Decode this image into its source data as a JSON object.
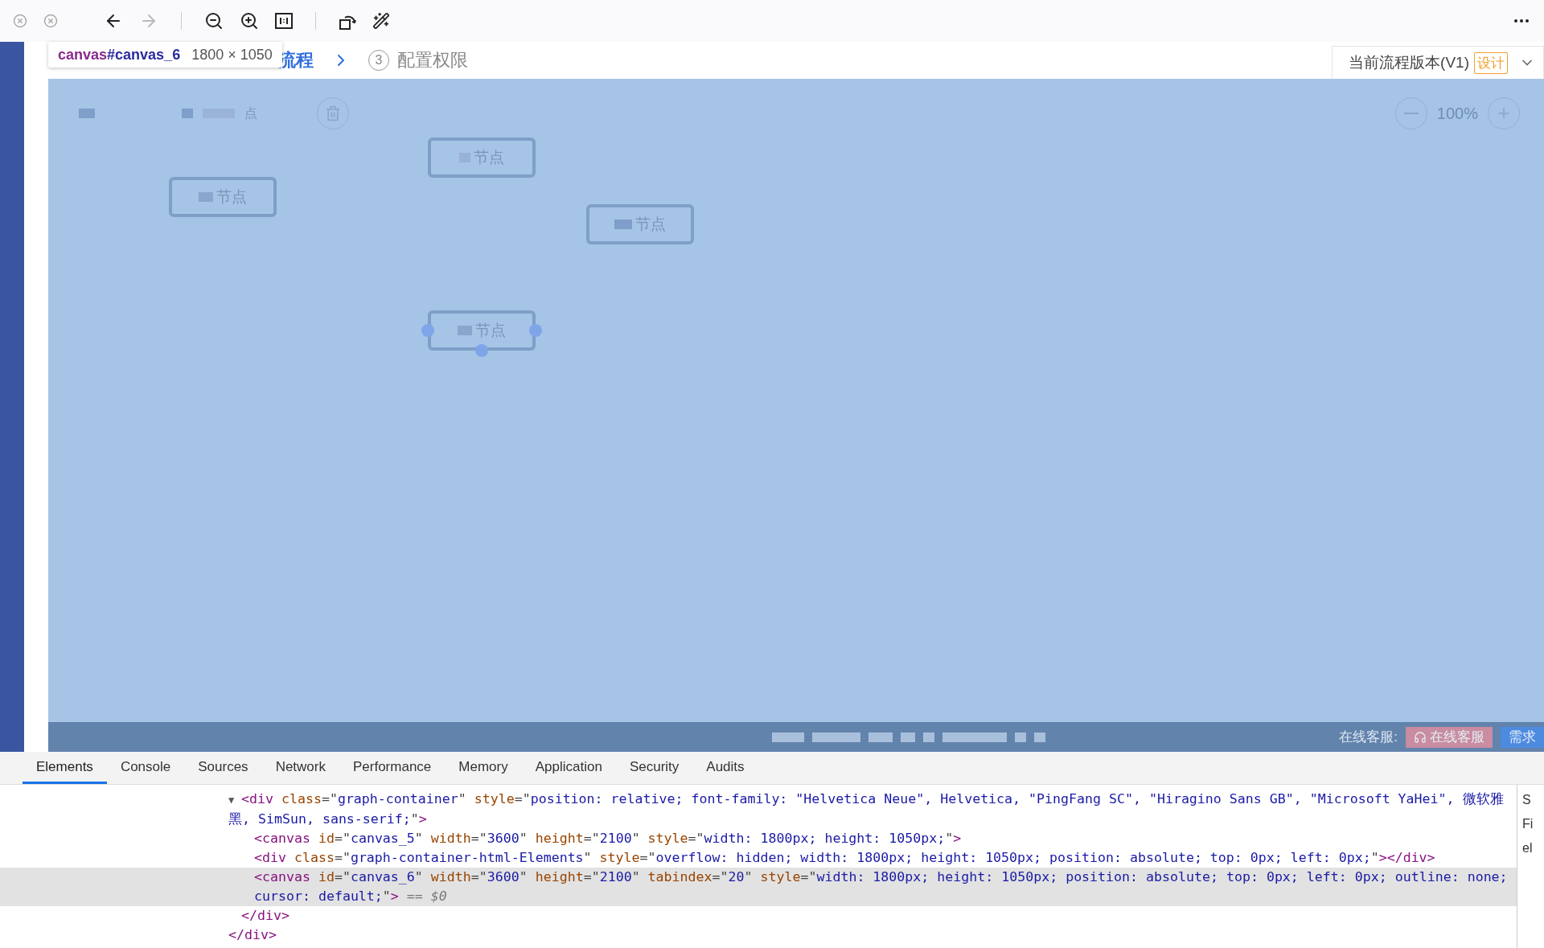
{
  "toolbar": {
    "forward_disabled": true
  },
  "tooltip": {
    "selector_tag": "canvas",
    "selector_id": "#canvas_6",
    "size": "1800 × 1050"
  },
  "steps": [
    {
      "label": "流程",
      "selected": true
    },
    {
      "number": "3",
      "label": "配置权限",
      "selected": false
    }
  ],
  "version": {
    "label": "当前流程版本(V1)",
    "badge": "设计"
  },
  "canvas_toolbar": {
    "left_text": "点",
    "zoom": "100%"
  },
  "nodes": [
    {
      "label": "节点",
      "selected": false
    },
    {
      "label": "节点",
      "selected": false
    },
    {
      "label": "节点",
      "selected": false
    },
    {
      "label": "节点",
      "selected": true
    }
  ],
  "footer": {
    "service_label": "在线客服:",
    "service_button": "在线客服",
    "demand_button": "需求"
  },
  "devtools": {
    "tabs": [
      {
        "label": "Elements",
        "selected": true
      },
      {
        "label": "Console",
        "selected": false
      },
      {
        "label": "Sources",
        "selected": false
      },
      {
        "label": "Network",
        "selected": false
      },
      {
        "label": "Performance",
        "selected": false
      },
      {
        "label": "Memory",
        "selected": false
      },
      {
        "label": "Application",
        "selected": false
      },
      {
        "label": "Security",
        "selected": false
      },
      {
        "label": "Audits",
        "selected": false
      }
    ],
    "tree": [
      {
        "expander": "▼",
        "selected": false,
        "segments": [
          {
            "kind": "tag",
            "text": "<div "
          },
          {
            "kind": "attr",
            "text": "class"
          },
          {
            "kind": "punct",
            "text": "=\""
          },
          {
            "kind": "value",
            "text": "graph-container"
          },
          {
            "kind": "punct",
            "text": "\" "
          },
          {
            "kind": "attr",
            "text": "style"
          },
          {
            "kind": "punct",
            "text": "=\""
          },
          {
            "kind": "value",
            "text": "position: relative; font-family: \"Helvetica Neue\", Helvetica, \"PingFang SC\", \"Hiragino Sans GB\", \"Microsoft YaHei\", 微软雅黑, SimSun, sans-serif;"
          },
          {
            "kind": "punct",
            "text": "\""
          },
          {
            "kind": "tag",
            "text": ">"
          }
        ],
        "children": [
          {
            "selected": false,
            "segments": [
              {
                "kind": "tag",
                "text": "<canvas "
              },
              {
                "kind": "attr",
                "text": "id"
              },
              {
                "kind": "punct",
                "text": "=\""
              },
              {
                "kind": "value",
                "text": "canvas_5"
              },
              {
                "kind": "punct",
                "text": "\" "
              },
              {
                "kind": "attr",
                "text": "width"
              },
              {
                "kind": "punct",
                "text": "=\""
              },
              {
                "kind": "value",
                "text": "3600"
              },
              {
                "kind": "punct",
                "text": "\" "
              },
              {
                "kind": "attr",
                "text": "height"
              },
              {
                "kind": "punct",
                "text": "=\""
              },
              {
                "kind": "value",
                "text": "2100"
              },
              {
                "kind": "punct",
                "text": "\" "
              },
              {
                "kind": "attr",
                "text": "style"
              },
              {
                "kind": "punct",
                "text": "=\""
              },
              {
                "kind": "value",
                "text": "width: 1800px; height: 1050px;"
              },
              {
                "kind": "punct",
                "text": "\""
              },
              {
                "kind": "tag",
                "text": ">"
              }
            ]
          },
          {
            "selected": false,
            "segments": [
              {
                "kind": "tag",
                "text": "<div "
              },
              {
                "kind": "attr",
                "text": "class"
              },
              {
                "kind": "punct",
                "text": "=\""
              },
              {
                "kind": "value",
                "text": "graph-container-html-Elements"
              },
              {
                "kind": "punct",
                "text": "\" "
              },
              {
                "kind": "attr",
                "text": "style"
              },
              {
                "kind": "punct",
                "text": "=\""
              },
              {
                "kind": "value",
                "text": "overflow: hidden; width: 1800px; height: 1050px; position: absolute; top: 0px; left: 0px;"
              },
              {
                "kind": "punct",
                "text": "\""
              },
              {
                "kind": "tag",
                "text": "></div>"
              }
            ]
          },
          {
            "selected": true,
            "segments": [
              {
                "kind": "tag",
                "text": "<canvas "
              },
              {
                "kind": "attr",
                "text": "id"
              },
              {
                "kind": "punct",
                "text": "=\""
              },
              {
                "kind": "value",
                "text": "canvas_6"
              },
              {
                "kind": "punct",
                "text": "\" "
              },
              {
                "kind": "attr",
                "text": "width"
              },
              {
                "kind": "punct",
                "text": "=\""
              },
              {
                "kind": "value",
                "text": "3600"
              },
              {
                "kind": "punct",
                "text": "\" "
              },
              {
                "kind": "attr",
                "text": "height"
              },
              {
                "kind": "punct",
                "text": "=\""
              },
              {
                "kind": "value",
                "text": "2100"
              },
              {
                "kind": "punct",
                "text": "\" "
              },
              {
                "kind": "attr",
                "text": "tabindex"
              },
              {
                "kind": "punct",
                "text": "=\""
              },
              {
                "kind": "value",
                "text": "20"
              },
              {
                "kind": "punct",
                "text": "\" "
              },
              {
                "kind": "attr",
                "text": "style"
              },
              {
                "kind": "punct",
                "text": "=\""
              },
              {
                "kind": "value",
                "text": "width: 1800px; height: 1050px; position: absolute; top: 0px; left: 0px; outline: none; cursor: default;"
              },
              {
                "kind": "punct",
                "text": "\""
              },
              {
                "kind": "tag",
                "text": ">"
              },
              {
                "kind": "note",
                "text": " == $0"
              }
            ]
          }
        ],
        "closing": [
          {
            "kind": "tag",
            "text": "</div>"
          }
        ]
      }
    ],
    "outer_closing": [
      {
        "kind": "tag",
        "text": "</div>"
      }
    ],
    "sidebar_letters": [
      "S",
      "Fi",
      "el"
    ]
  }
}
